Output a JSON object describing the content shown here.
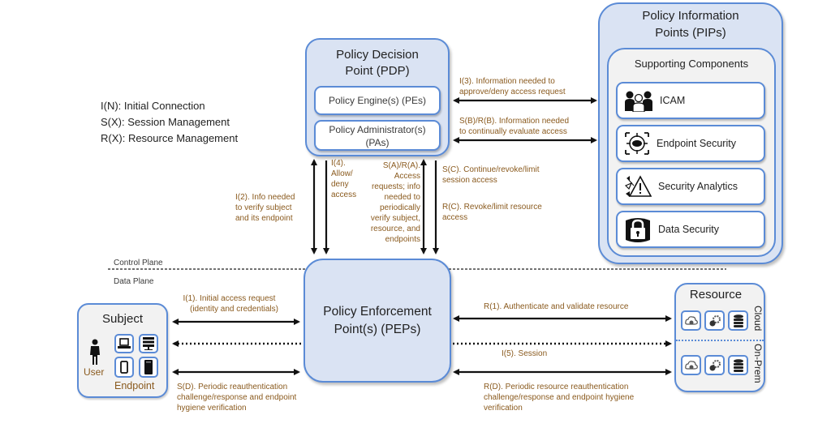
{
  "legend": [
    "I(N): Initial Connection",
    "S(X): Session Management",
    "R(X): Resource Management"
  ],
  "pdp": {
    "title_line1": "Policy Decision",
    "title_line2": "Point (PDP)",
    "engine": "Policy Engine(s) (PEs)",
    "admin_line1": "Policy Administrator(s)",
    "admin_line2": "(PAs)"
  },
  "pip": {
    "title_line1": "Policy Information",
    "title_line2": "Points (PIPs)",
    "supporting": "Supporting Components",
    "items": [
      {
        "label": "ICAM",
        "icon": "users-icon"
      },
      {
        "label": "Endpoint Security",
        "icon": "bug-target-icon"
      },
      {
        "label": "Security Analytics",
        "icon": "warning-analytics-icon"
      },
      {
        "label": "Data Security",
        "icon": "database-lock-icon"
      }
    ]
  },
  "pep": {
    "title_line1": "Policy Enforcement",
    "title_line2": "Point(s) (PEPs)"
  },
  "subject": {
    "title": "Subject",
    "user": "User",
    "endpoint": "Endpoint",
    "devices": [
      "laptop-icon",
      "server-icon",
      "phone-icon",
      "tower-icon"
    ]
  },
  "resource": {
    "title": "Resource",
    "cloud": "Cloud",
    "onprem": "On-Prem",
    "icons": [
      "cloud-gear-icon",
      "gears-icon",
      "database-icon"
    ]
  },
  "planes": {
    "control": "Control Plane",
    "data": "Data Plane"
  },
  "flows": {
    "i3_line1": "I(3). Information needed to",
    "i3_line2": "approve/deny access request",
    "sb_line1": "S(B)/R(B). Information needed",
    "sb_line2": "to continually evaluate access",
    "i2": [
      "I(2). Info needed",
      "to verify subject",
      "and its endpoint"
    ],
    "i4": [
      "I(4).",
      "Allow/",
      "deny",
      "access"
    ],
    "sa": [
      "S(A)/R(A).",
      "Access",
      "requests; info",
      "needed to",
      "periodically",
      "verify subject,",
      "resource, and",
      "endpoints"
    ],
    "sc": [
      "S(C). Continue/revoke/limit",
      "session access"
    ],
    "rc": [
      "R(C). Revoke/limit resource",
      "access"
    ],
    "i1": [
      "I(1). Initial access request",
      "(identity and credentials)"
    ],
    "sd": [
      "S(D). Periodic reauthentication",
      "challenge/response and endpoint",
      "hygiene verification"
    ],
    "r1": "R(1). Authenticate and validate resource",
    "i5": "I(5). Session",
    "rd": [
      "R(D). Periodic resource reauthentication",
      "challenge/response and endpoint hygiene",
      "verification"
    ]
  }
}
